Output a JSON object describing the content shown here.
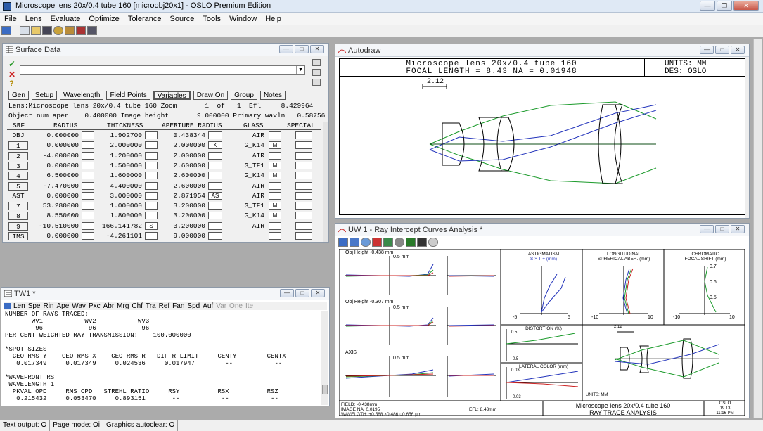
{
  "app": {
    "title": "Microscope lens 20x/0.4 tube 160 [microobj20x1] - OSLO Premium Edition"
  },
  "menu": [
    "File",
    "Lens",
    "Evaluate",
    "Optimize",
    "Tolerance",
    "Source",
    "Tools",
    "Window",
    "Help"
  ],
  "surface": {
    "title": "Surface Data",
    "tabs": [
      "Gen",
      "Setup",
      "Wavelength",
      "Field Points",
      "Variables",
      "Draw On",
      "Group",
      "Notes"
    ],
    "info1": "Lens:Microscope lens 20x/0.4 tube 160 Zoom       1  of   1  Efl     8.429964",
    "info2": "Object num aper    0.400000 Image height       9.000000 Primary wavln   0.58756",
    "headers": [
      "SRF",
      "RADIUS",
      "THICKNESS",
      "APERTURE RADIUS",
      "GLASS",
      "SPECIAL"
    ],
    "rows": [
      {
        "srf": "OBJ",
        "radius": "0.000000",
        "rb": "",
        "thick": "1.902700",
        "tb": "",
        "ap": "0.438344",
        "ab": "",
        "glass": "AIR",
        "gb": ""
      },
      {
        "srf": "1",
        "radius": "0.000000",
        "rb": "",
        "thick": "2.000000",
        "tb": "",
        "ap": "2.000000",
        "ab": "K",
        "glass": "G_K14",
        "gb": "M"
      },
      {
        "srf": "2",
        "radius": "-4.000000",
        "rb": "",
        "thick": "1.200000",
        "tb": "",
        "ap": "2.000000",
        "ab": "",
        "glass": "AIR",
        "gb": ""
      },
      {
        "srf": "3",
        "radius": "0.000000",
        "rb": "",
        "thick": "1.500000",
        "tb": "",
        "ap": "2.600000",
        "ab": "",
        "glass": "G_TF1",
        "gb": "M"
      },
      {
        "srf": "4",
        "radius": "6.500000",
        "rb": "",
        "thick": "1.600000",
        "tb": "",
        "ap": "2.600000",
        "ab": "",
        "glass": "G_K14",
        "gb": "M"
      },
      {
        "srf": "5",
        "radius": "-7.470000",
        "rb": "",
        "thick": "4.400000",
        "tb": "",
        "ap": "2.600000",
        "ab": "",
        "glass": "AIR",
        "gb": ""
      },
      {
        "srf": "AST",
        "radius": "0.000000",
        "rb": "",
        "thick": "3.000000",
        "tb": "",
        "ap": "2.871954",
        "ab": "AS",
        "glass": "AIR",
        "gb": ""
      },
      {
        "srf": "7",
        "radius": "53.280000",
        "rb": "",
        "thick": "1.000000",
        "tb": "",
        "ap": "3.200000",
        "ab": "",
        "glass": "G_TF1",
        "gb": "M"
      },
      {
        "srf": "8",
        "radius": "8.550000",
        "rb": "",
        "thick": "1.800000",
        "tb": "",
        "ap": "3.200000",
        "ab": "",
        "glass": "G_K14",
        "gb": "M"
      },
      {
        "srf": "9",
        "radius": "-10.510000",
        "rb": "",
        "thick": "166.141782",
        "tb": "S",
        "ap": "3.200000",
        "ab": "",
        "glass": "AIR",
        "gb": ""
      },
      {
        "srf": "IMS",
        "radius": "0.000000",
        "rb": "",
        "thick": "-4.261101",
        "tb": "",
        "ap": "9.000000",
        "ab": "",
        "glass": "",
        "gb": ""
      }
    ]
  },
  "tw": {
    "title": "TW1 *",
    "tabs": [
      "Len",
      "Spe",
      "Rin",
      "Ape",
      "Wav",
      "Pxc",
      "Abr",
      "Mrg",
      "Chf",
      "Tra",
      "Ref",
      "Fan",
      "Spd",
      "Auf",
      "Var",
      "One",
      "Ite"
    ],
    "lines": [
      "NUMBER OF RAYS TRACED:",
      "       WV1           WV2           WV3",
      "        96            96            96",
      "PER CENT WEIGHTED RAY TRANSMISSION:    100.000000",
      "",
      "*SPOT SIZES",
      "  GEO RMS Y    GEO RMS X    GEO RMS R   DIFFR LIMIT     CENTY        CENTX",
      "   0.017349     0.017349     0.024536     0.017947        --           --",
      "",
      "*WAVEFRONT RS",
      " WAVELENGTH 1",
      "  PKVAL OPD     RMS OPD   STREHL RATIO     RSY          RSX          RSZ",
      "   0.215432     0.053470     0.893151       --           --           --"
    ]
  },
  "autodraw": {
    "title": "Autodraw",
    "line1": "Microscope lens 20x/0.4 tube 160",
    "line2": "FOCAL LENGTH = 8.43   NA = 0.01948",
    "units": "UNITS: MM",
    "des": "DES: OSLO",
    "scale": "2.12"
  },
  "uw": {
    "title": "UW 1 - Ray Intercept Curves Analysis *",
    "fields": [
      "Obj Height -0.438 mm",
      "Obj Height -0.307 mm",
      "AXIS"
    ],
    "axis_label": "0.5 mm",
    "astig": {
      "title": "ASTIGMATISM",
      "sub": "S × T +  (mm)",
      "xmin": "-5",
      "xmax": "5"
    },
    "sph": {
      "title": "LONGITUDINAL",
      "sub": "SPHERICAL ABER. (mm)",
      "xmin": "-10",
      "xmax": "10"
    },
    "chrom": {
      "title": "CHROMATIC",
      "sub": "FOCAL SHIFT (mm)",
      "ticks": [
        "0.7",
        "0.6",
        "0.5"
      ],
      "xmin": "-10",
      "xmax": "10"
    },
    "dist": {
      "title": "DISTORTION (%)",
      "top": "0.5",
      "bot": "-0.5"
    },
    "lat": {
      "title": "LATERAL COLOR (mm)",
      "top": "0.03",
      "bot": "-0.03"
    },
    "scale": "2.12",
    "units": "UNITS: MM",
    "field": "FIELD: -0.438mm",
    "na": "IMAGE NA: 0.0195",
    "efl": "EFL: 8.43mm",
    "wave": "WAVELGTH: +0.588 ×0.486 ○0.656 μm",
    "desc1": "Microscope lens 20x/0.4 tube 160",
    "desc2": "RAY TRACE ANALYSIS",
    "brand": "OSLO",
    "date": "19 13",
    "time": "11:16 PM"
  },
  "status": [
    "Text output: O",
    "Page mode: Oi",
    "Graphics autoclear: O"
  ]
}
